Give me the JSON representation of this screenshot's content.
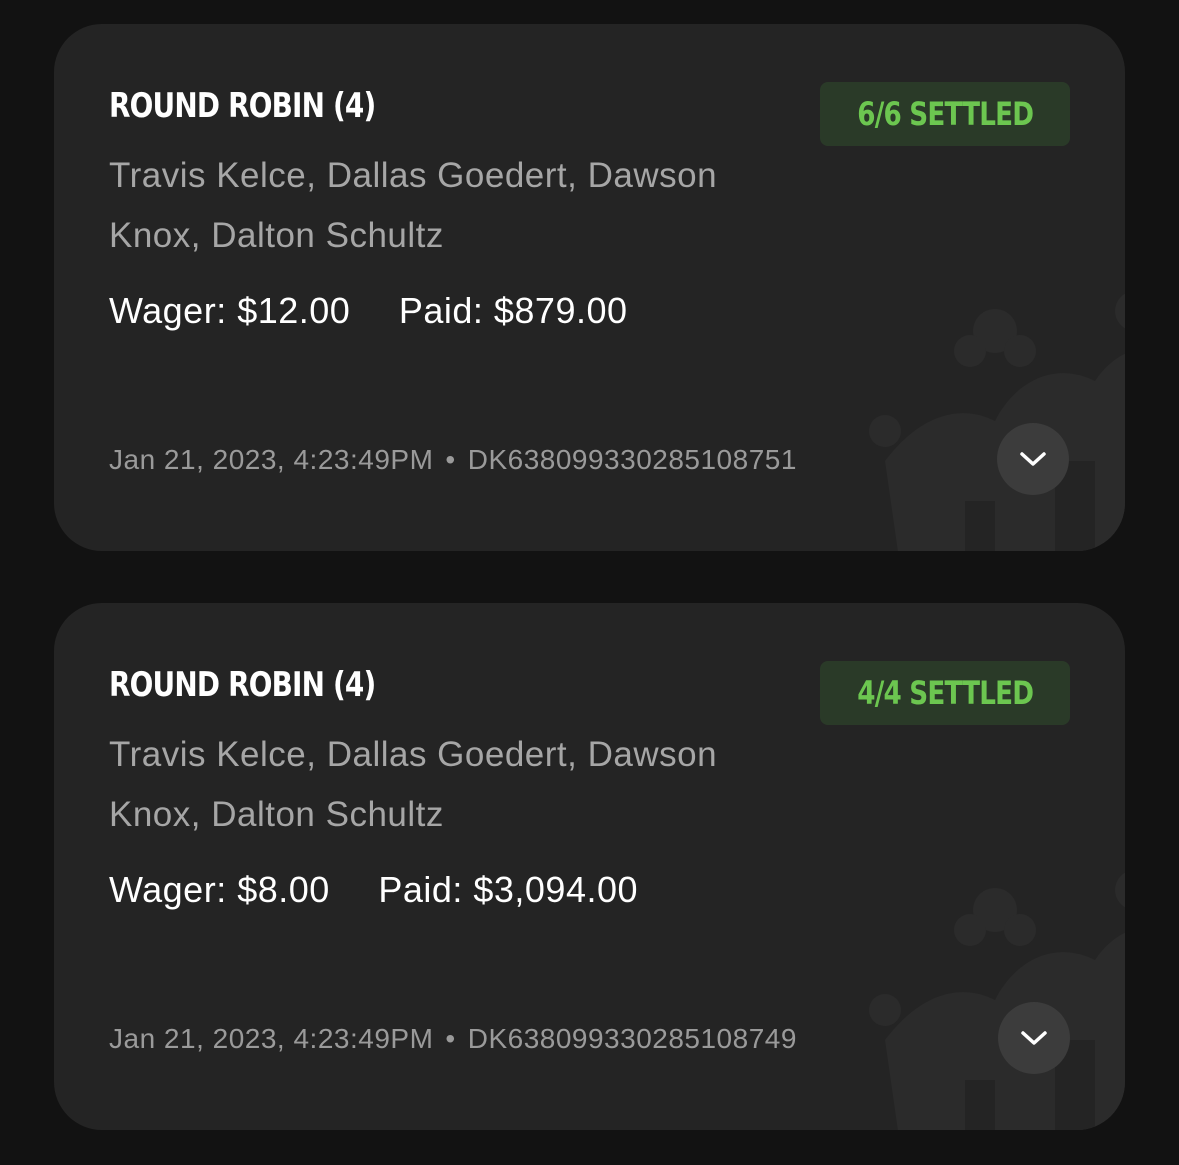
{
  "bets": [
    {
      "title": "ROUND ROBIN (4)",
      "status": "6/6 SETTLED",
      "players": "Travis Kelce, Dallas Goedert, Dawson Knox, Dalton Schultz",
      "wager": "Wager: $12.00",
      "paid": "Paid: $879.00",
      "date": "Jan 21, 2023, 4:23:49PM",
      "separator": "•",
      "bet_id": "DK638099330285108751",
      "expand_icon": "chevron-down-icon"
    },
    {
      "title": "ROUND ROBIN (4)",
      "status": "4/4 SETTLED",
      "players": "Travis Kelce, Dallas Goedert, Dawson Knox, Dalton Schultz",
      "wager": "Wager: $8.00",
      "paid": "Paid: $3,094.00",
      "date": "Jan 21, 2023, 4:23:49PM",
      "separator": "•",
      "bet_id": "DK638099330285108749",
      "expand_icon": "chevron-down-icon"
    }
  ],
  "colors": {
    "background": "#121212",
    "card": "#242424",
    "status_green": "#6cc650",
    "badge_bg": "#2a3a28"
  }
}
